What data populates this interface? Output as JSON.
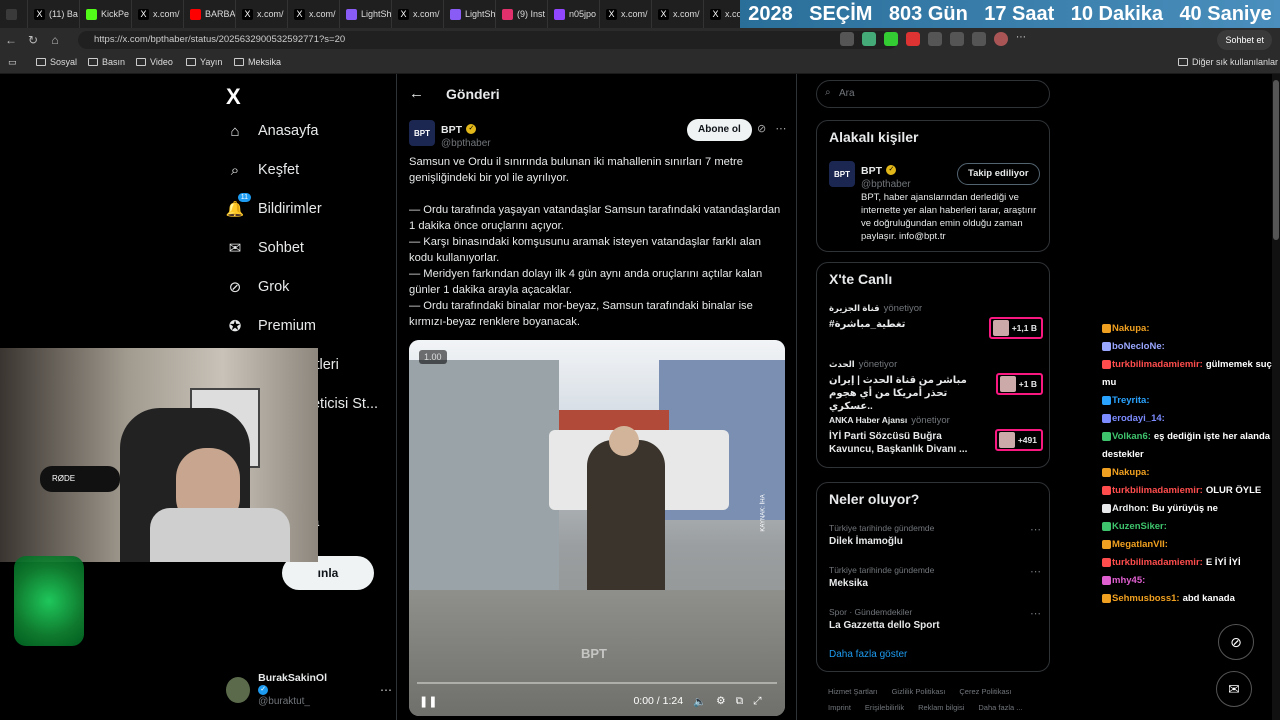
{
  "browser": {
    "tabs": [
      {
        "label": "",
        "icon": "tabs-icon",
        "color": "#3a3a3a"
      },
      {
        "label": "(11) Ba",
        "icon": "x-logo-icon",
        "color": "#000000"
      },
      {
        "label": "KickPe",
        "icon": "kick-icon",
        "color": "#53fc18"
      },
      {
        "label": "x.com/",
        "icon": "x-logo-icon",
        "color": "#000000"
      },
      {
        "label": "BARBA",
        "icon": "youtube-icon",
        "color": "#ff0000"
      },
      {
        "label": "x.com/",
        "icon": "x-logo-icon",
        "color": "#000000"
      },
      {
        "label": "x.com/",
        "icon": "x-logo-icon",
        "color": "#000000"
      },
      {
        "label": "LightSh",
        "icon": "feather-icon",
        "color": "#8a5cf6"
      },
      {
        "label": "x.com/",
        "icon": "x-logo-icon",
        "color": "#000000"
      },
      {
        "label": "LightSh",
        "icon": "feather-icon",
        "color": "#8a5cf6"
      },
      {
        "label": "(9) Inst",
        "icon": "instagram-icon",
        "color": "#e1306c"
      },
      {
        "label": "n05jpo",
        "icon": "twitch-icon",
        "color": "#9146ff"
      },
      {
        "label": "x.com/",
        "icon": "x-logo-icon",
        "color": "#000000"
      },
      {
        "label": "x.com/",
        "icon": "x-logo-icon",
        "color": "#000000"
      },
      {
        "label": "x.com/",
        "icon": "x-logo-icon",
        "color": "#000000"
      }
    ],
    "countdown": [
      "2028",
      "SEÇİM",
      "803 Gün",
      "17 Saat",
      "10 Dakika",
      "40 Saniye"
    ],
    "url": "https://x.com/bpthaber/status/2025632900532592771?s=20",
    "chat_button": "Sohbet et",
    "bookmarks": [
      "Sosyal",
      "Basın",
      "Video",
      "Yayın",
      "Meksika"
    ],
    "bookmarks_right": "Diğer sık kullanılanlar"
  },
  "nav": {
    "logo": "X",
    "items": [
      {
        "label": "Anasayfa",
        "icon": "home-icon",
        "glyph": "⌂"
      },
      {
        "label": "Keşfet",
        "icon": "search-icon",
        "glyph": "⌕"
      },
      {
        "label": "Bildirimler",
        "icon": "bell-icon",
        "glyph": "🔔"
      },
      {
        "label": "Sohbet",
        "icon": "mail-icon",
        "glyph": "✉"
      },
      {
        "label": "Grok",
        "icon": "grok-icon",
        "glyph": "⊘"
      },
      {
        "label": "Premium",
        "icon": "premium-icon",
        "glyph": "✪"
      },
      {
        "label": "Yer İşaretleri",
        "icon": "bookmark-icon",
        "glyph": "🔖"
      },
      {
        "label": "İçerik Üreticisi St...",
        "icon": "creator-icon",
        "glyph": "⚗"
      }
    ],
    "notif_badge": "11",
    "post_button_partial": "ınla",
    "partial_item": "a",
    "account": {
      "name": "BurakSakinOl",
      "handle": "@buraktut_"
    }
  },
  "post": {
    "header_title": "Gönderi",
    "author": {
      "name": "BPT",
      "handle": "@bpthaber",
      "avatar": "BPT"
    },
    "follow_label": "Abone ol",
    "text_lines": [
      "Samsun ve Ordu il sınırında bulunan iki mahallenin sınırları 7 metre genişliğindeki bir yol ile ayrılıyor.",
      "",
      "— Ordu tarafında yaşayan vatandaşlar Samsun tarafındaki vatandaşlardan 1 dakika önce oruçlarını açıyor.",
      "— Karşı binasındaki komşusunu aramak isteyen vatandaşlar farklı alan kodu kullanıyorlar.",
      "— Meridyen farkından dolayı ilk 4 gün aynı anda oruçlarını açtılar kalan günler 1 dakika arayla açacaklar.",
      "— Ordu tarafındaki binalar mor-beyaz, Samsun tarafındaki binalar ise kırmızı-beyaz renklere boyanacak."
    ],
    "video": {
      "speed_badge": "1.00",
      "time": "0:00 / 1:24",
      "watermark": "BPT",
      "side_text": "KAYNAK: İHA",
      "progress": 0.0
    }
  },
  "right": {
    "search_placeholder": "Ara",
    "related": {
      "title": "Alakalı kişiler",
      "name": "BPT",
      "handle": "@bpthaber",
      "button": "Takip ediliyor",
      "bio": "BPT, haber ajanslarından derlediği ve internette yer alan haberleri tarar, araştırır ve doğruluğundan emin olduğu zaman paylaşır. info@bpt.tr"
    },
    "live": {
      "title": "X'te Canlı",
      "items": [
        {
          "host": "قناة الجزيرة",
          "status": "yönetiyor",
          "title": "#تغطية_مباشرة",
          "count": "+1,1 B"
        },
        {
          "host": "الحدث",
          "status": "yönetiyor",
          "title": "مباشر من قناة الحدث | إيران تحذر أمريكا من أي هجوم عسكري..",
          "count": "+1 B"
        },
        {
          "host": "ANKA Haber Ajansı",
          "status": "yönetiyor",
          "title": "İYİ Parti Sözcüsü Buğra Kavuncu, Başkanlık Divanı ...",
          "count": "+491"
        }
      ]
    },
    "trends": {
      "title": "Neler oluyor?",
      "items": [
        {
          "meta": "Türkiye tarihinde gündemde",
          "title": "Dilek İmamoğlu"
        },
        {
          "meta": "Türkiye tarihinde gündemde",
          "title": "Meksika"
        },
        {
          "meta": "Spor · Gündemdekiler",
          "title": "La Gazzetta dello Sport"
        }
      ],
      "more": "Daha fazla göster"
    },
    "footer": [
      "Hizmet Şartları",
      "Gizlilik Politikası",
      "Çerez Politikası",
      "Imprint",
      "Erişilebilirlik",
      "Reklam bilgisi",
      "Daha fazla ..."
    ]
  },
  "stream_chat": [
    {
      "user": "Nakupa:",
      "msg": "",
      "color": "#f0a020"
    },
    {
      "user": "boNecloNe:",
      "msg": "",
      "color": "#9aa7ff"
    },
    {
      "user": "turkbilimadamiemir:",
      "msg": "gülmemek suç mu",
      "color": "#ff4d4d"
    },
    {
      "user": "Treyrita:",
      "msg": "",
      "color": "#2aa3ff"
    },
    {
      "user": "erodayi_14:",
      "msg": "",
      "color": "#7c8cff"
    },
    {
      "user": "Volkan6:",
      "msg": "eş dediğin işte her alanda destekler",
      "color": "#3ec46d"
    },
    {
      "user": "Nakupa:",
      "msg": "",
      "color": "#f0a020"
    },
    {
      "user": "turkbilimadamiemir:",
      "msg": "OLUR ÖYLE",
      "color": "#ff4d4d"
    },
    {
      "user": "Ardhon:",
      "msg": "Bu yürüyüş ne",
      "color": "#e7e9ea"
    },
    {
      "user": "KuzenSiker:",
      "msg": "",
      "color": "#3ec46d"
    },
    {
      "user": "MegatlanVII:",
      "msg": "",
      "color": "#f0a020"
    },
    {
      "user": "turkbilimadamiemir:",
      "msg": "E İYİ İYİ",
      "color": "#ff4d4d"
    },
    {
      "user": "mhy45:",
      "msg": "",
      "color": "#e05fd0"
    },
    {
      "user": "Sehmusboss1:",
      "msg": "abd kanada",
      "color": "#f0a020"
    }
  ],
  "colors": {
    "accent": "#1d9bf0",
    "live_border": "#f91880",
    "gold_verified": "#e2b719"
  }
}
